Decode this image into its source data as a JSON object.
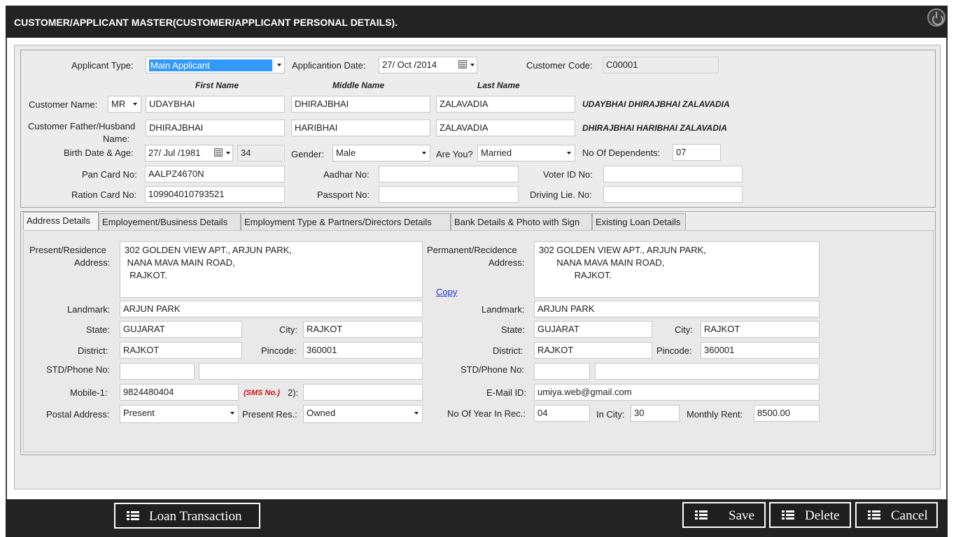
{
  "window": {
    "title": "CUSTOMER/APPLICANT MASTER(CUSTOMER/APPLICANT PERSONAL DETAILS)."
  },
  "personal": {
    "applicant_type": {
      "label": "Applicant Type:",
      "value": "Main Applicant"
    },
    "application_date": {
      "label": "Applicantion Date:",
      "value": "27/ Oct /2014"
    },
    "customer_code": {
      "label": "Customer Code:",
      "value": "C00001"
    },
    "headers": {
      "first": "First Name",
      "middle": "Middle Name",
      "last": "Last Name"
    },
    "customer_name": {
      "label": "Customer Name:",
      "title": "MR",
      "first": "UDAYBHAI",
      "middle": "DHIRAJBHAI",
      "last": "ZALAVADIA",
      "full": "UDAYBHAI DHIRAJBHAI ZALAVADIA"
    },
    "father_husband": {
      "label_line1": "Customer Father/Husband",
      "label_line2": "Name:",
      "first": "DHIRAJBHAI",
      "middle": "HARIBHAI",
      "last": "ZALAVADIA",
      "full": "DHIRAJBHAI HARIBHAI ZALAVADIA"
    },
    "birth": {
      "label": "Birth Date & Age:",
      "date": "27/ Jul /1981",
      "age": "34"
    },
    "gender": {
      "label": "Gender:",
      "value": "Male"
    },
    "marital": {
      "label": "Are You?",
      "value": "Married"
    },
    "dependents": {
      "label": "No Of Dependents:",
      "value": "07"
    },
    "pan": {
      "label": "Pan Card No:",
      "value": "AALPZ4670N"
    },
    "aadhar": {
      "label": "Aadhar No:",
      "value": ""
    },
    "voter": {
      "label": "Voter ID No:",
      "value": ""
    },
    "ration": {
      "label": "Ration Card No:",
      "value": "109904010793521"
    },
    "passport": {
      "label": "Passport No:",
      "value": ""
    },
    "driving": {
      "label": "Driving Lie. No:",
      "value": ""
    }
  },
  "tabs": [
    {
      "label": "Address Details"
    },
    {
      "label": "Employement/Business Details"
    },
    {
      "label": "Employment Type & Partners/Directors Details"
    },
    {
      "label": "Bank Details & Photo with Sign"
    },
    {
      "label": "Existing Loan Details"
    }
  ],
  "address": {
    "present": {
      "label_line1": "Present/Residence",
      "label_line2": "Address:",
      "value": "302 GOLDEN VIEW APT., ARJUN PARK,\n NANA MAVA MAIN ROAD,\n  RAJKOT.",
      "landmark_label": "Landmark:",
      "landmark": "ARJUN PARK",
      "state_label": "State:",
      "state": "GUJARAT",
      "city_label": "City:",
      "city": "RAJKOT",
      "district_label": "District:",
      "district": "RAJKOT",
      "pincode_label": "Pincode:",
      "pincode": "360001",
      "phone_label": "STD/Phone No:",
      "std": "",
      "phone": "",
      "mobile_label": "Mobile-1:",
      "mobile1": "9824480404",
      "sms_label": "(SMS No.)",
      "mobile2_label": "2):",
      "mobile2": "",
      "postal_label": "Postal Address:",
      "postal": "Present",
      "res_label": "Present Res.:",
      "res": "Owned"
    },
    "copy_link": "Copy",
    "permanent": {
      "label_line1": "Permanent/Recidence",
      "label_line2": "Address:",
      "value": "302 GOLDEN VIEW APT., ARJUN PARK,\n       NANA MAVA MAIN ROAD,\n              RAJKOT.",
      "landmark_label": "Landmark:",
      "landmark": "ARJUN PARK",
      "state_label": "State:",
      "state": "GUJARAT",
      "city_label": "City:",
      "city": "RAJKOT",
      "district_label": "District:",
      "district": "RAJKOT",
      "pincode_label": "Pincode:",
      "pincode": "360001",
      "phone_label": "STD/Phone No:",
      "std": "",
      "phone": "",
      "email_label": "E-Mail ID:",
      "email": "umiya.web@gmail.com",
      "years_label": "No Of Year In Rec.:",
      "years": "04",
      "incity_label": "In City:",
      "incity": "30",
      "rent_label": "Monthly Rent:",
      "rent": "8500.00"
    }
  },
  "footer": {
    "loan_transaction": "Loan Transaction",
    "save": "Save",
    "delete": "Delete",
    "cancel": "Cancel"
  },
  "colors": {
    "titlebar": "#232323",
    "panel": "#ececec",
    "selection": "#3399ff",
    "sms": "#cc1111",
    "link": "#1a33cc"
  }
}
